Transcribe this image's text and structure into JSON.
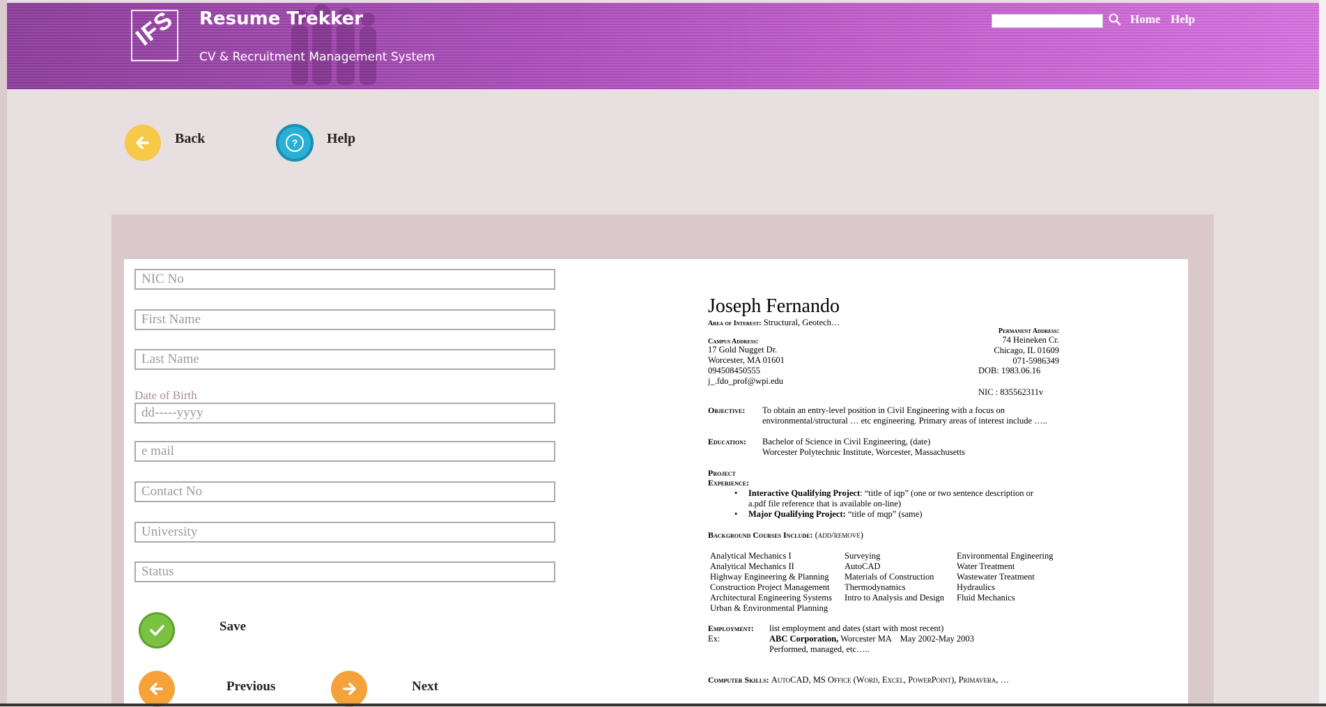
{
  "header": {
    "logo_text": "IFS",
    "app_title": "Resume Trekker",
    "app_subtitle": "CV & Recruitment Management System",
    "search": {
      "placeholder": "",
      "value": ""
    },
    "nav": [
      "Home",
      "Help"
    ]
  },
  "toolbar": {
    "back_label": "Back",
    "help_label": "Help"
  },
  "form": {
    "nic_placeholder": "NIC No",
    "first_name_placeholder": "First Name",
    "last_name_placeholder": "Last Name",
    "dob_label": "Date of Birth",
    "dob_placeholder": "dd-----yyyy",
    "email_placeholder": "e mail",
    "contact_placeholder": "Contact No",
    "university_placeholder": "University",
    "status_placeholder": "Status",
    "save_label": "Save",
    "previous_label": "Previous",
    "next_label": "Next"
  },
  "colors": {
    "header_purple": "#b04fc0",
    "back_yellow": "#f7c948",
    "help_blue": "#2ab0d6",
    "save_green": "#7cc242",
    "nav_orange": "#f5a23a"
  },
  "resume": {
    "name": "Joseph Fernando",
    "area_label": "Area of Interest:",
    "area_value": "Structural, Geotech…",
    "perm_label": "Permanent Address:",
    "perm_line1": "74 Heineken Cr.",
    "perm_line2": "Chicago, IL 01609",
    "perm_phone": "071-5986349",
    "dob": "DOB: 1983.06.16",
    "nic": "NIC : 835562311v",
    "campus_label": "Campus Address:",
    "campus_line1": "17 Gold Nugget Dr.",
    "campus_line2": "Worcester, MA 01601",
    "campus_phone": "094508450555",
    "campus_email": "j_.fdo_prof@wpi.edu",
    "objective_label": "Objective:",
    "objective_line1": "To obtain an entry-level position in Civil Engineering with a focus on",
    "objective_line2": "environmental/structural … etc engineering. Primary areas of interest include …..",
    "education_label": "Education:",
    "education_line1": "Bachelor of Science in Civil Engineering, (date)",
    "education_line2": "Worcester Polytechnic Institute, Worcester, Massachusetts",
    "project_label1": "Project",
    "project_label2": "Experience:",
    "iqp_bold": "Interactive Qualifying Project",
    "iqp_rest": ": “title of iqp” (one or two sentence description or",
    "iqp_line2": "a.pdf file reference that is available on-line)",
    "mqp_bold": "Major Qualifying Project:",
    "mqp_rest": " “title of mqp” (same)",
    "courses_label": "Background Courses Include:",
    "courses_note": "(add/remove)",
    "courses_col1": [
      "Analytical Mechanics I",
      "Analytical Mechanics II",
      "Highway Engineering & Planning",
      "Construction Project Management",
      "Architectural Engineering Systems",
      "Urban & Environmental Planning"
    ],
    "courses_col2": [
      "Surveying",
      "AutoCAD",
      "Materials of Construction",
      "Thermodynamics",
      "Intro to Analysis and Design"
    ],
    "courses_col3": [
      "Environmental Engineering",
      "Water Treatment",
      "Wastewater Treatment",
      "Hydraulics",
      "Fluid Mechanics"
    ],
    "employment_label": "Employment:",
    "employment_text": "list employment and dates (start with most recent)",
    "ex_label": "Ex:",
    "ex_company": "ABC Corporation,",
    "ex_rest": " Worcester MA    May 2002-May 2003",
    "ex_line2": "Performed, managed, etc…..",
    "skills_label": "Computer Skills:",
    "skills_text": "AutoCAD, MS Office (Word, Excel, PowerPoint), Primavera, …"
  }
}
